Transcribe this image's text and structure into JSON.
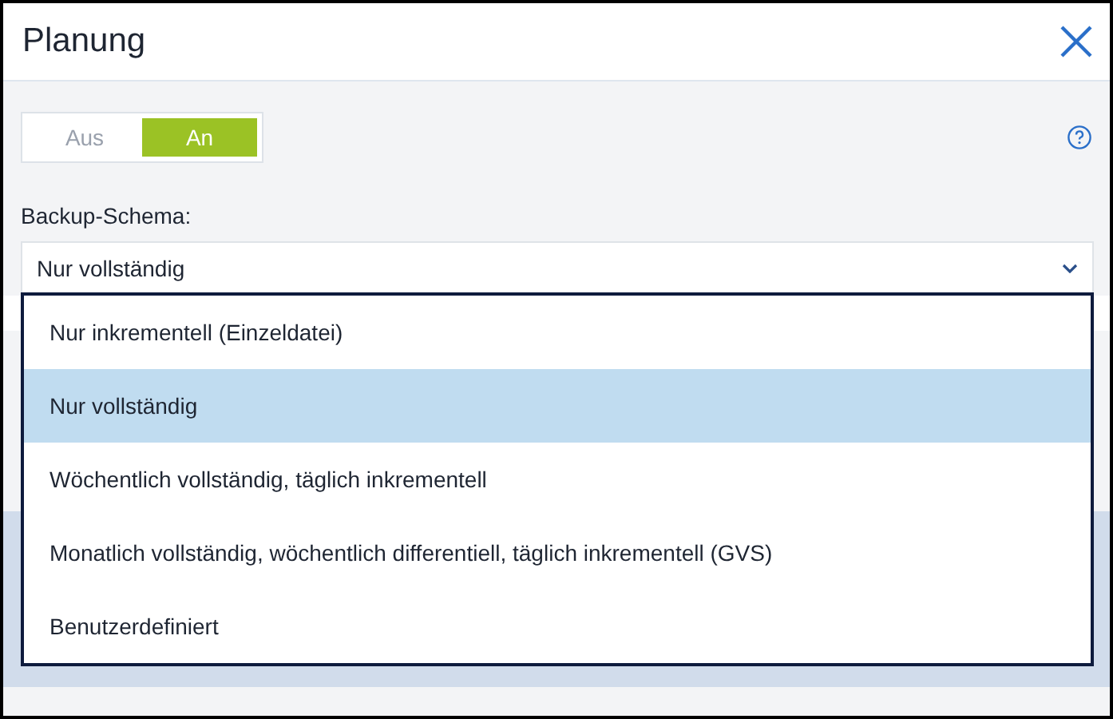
{
  "window": {
    "title": "Planung"
  },
  "toggle": [
    {
      "label": "Aus",
      "selected": false
    },
    {
      "label": "An",
      "selected": true
    }
  ],
  "backup_scheme": {
    "label": "Backup-Schema:",
    "value": "Nur vollständig",
    "expanded": true,
    "options": [
      {
        "label": "Nur inkrementell (Einzeldatei)",
        "selected": false
      },
      {
        "label": "Nur vollständig",
        "selected": true
      },
      {
        "label": "Wöchentlich vollständig, täglich inkrementell",
        "selected": false
      },
      {
        "label": "Monatlich vollständig, wöchentlich differentiell, täglich inkrementell (GVS)",
        "selected": false
      },
      {
        "label": "Benutzerdefiniert",
        "selected": false
      }
    ]
  }
}
